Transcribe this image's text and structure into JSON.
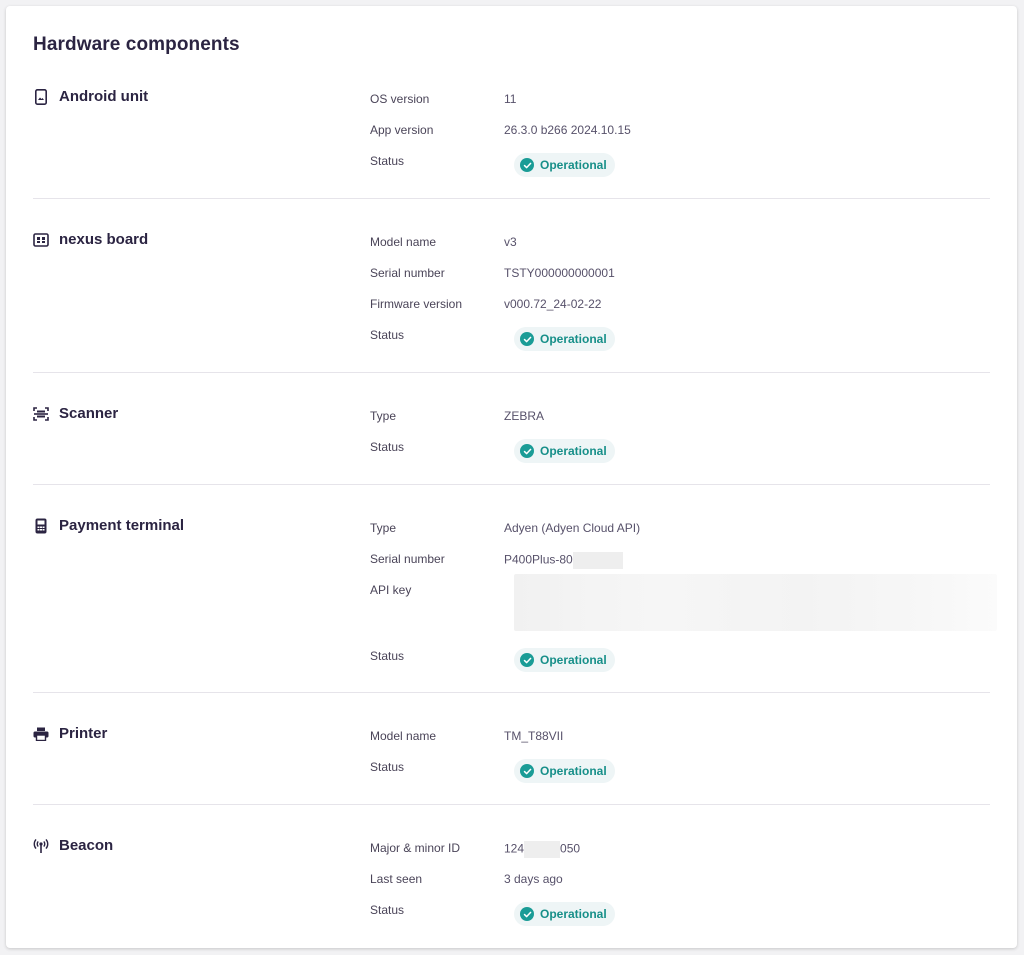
{
  "page": {
    "title": "Hardware components"
  },
  "components": [
    {
      "name": "Android unit",
      "icon": "tablet-icon",
      "fields": [
        {
          "label": "OS version",
          "value": "11"
        },
        {
          "label": "App version",
          "value": "26.3.0 b266 2024.10.15"
        }
      ],
      "status_label": "Status",
      "status": "Operational"
    },
    {
      "name": "nexus board",
      "icon": "board-icon",
      "fields": [
        {
          "label": "Model name",
          "value": "v3"
        },
        {
          "label": "Serial number",
          "value": "TSTY000000000001"
        },
        {
          "label": "Firmware version",
          "value": "v000.72_24-02-22"
        }
      ],
      "status_label": "Status",
      "status": "Operational"
    },
    {
      "name": "Scanner",
      "icon": "scanner-icon",
      "fields": [
        {
          "label": "Type",
          "value": "ZEBRA"
        }
      ],
      "status_label": "Status",
      "status": "Operational"
    },
    {
      "name": "Payment terminal",
      "icon": "payment-terminal-icon",
      "fields": [
        {
          "label": "Type",
          "value": "Adyen (Adyen Cloud API)"
        },
        {
          "label": "Serial number",
          "value": "P400Plus-80"
        },
        {
          "label": "API key",
          "value": ""
        }
      ],
      "status_label": "Status",
      "status": "Operational"
    },
    {
      "name": "Printer",
      "icon": "printer-icon",
      "fields": [
        {
          "label": "Model name",
          "value": "TM_T88VII"
        }
      ],
      "status_label": "Status",
      "status": "Operational"
    },
    {
      "name": "Beacon",
      "icon": "beacon-icon",
      "fields": [
        {
          "label": "Major & minor ID",
          "value_prefix": "124",
          "value_suffix": "050"
        },
        {
          "label": "Last seen",
          "value": "3 days ago"
        }
      ],
      "status_label": "Status",
      "status": "Operational"
    }
  ],
  "colors": {
    "heading": "#2b2442",
    "label": "#4a4458",
    "value": "#57516a",
    "status_accent": "#1a9c96",
    "status_bg": "#eef5f6",
    "divider": "#e6e4ea"
  }
}
